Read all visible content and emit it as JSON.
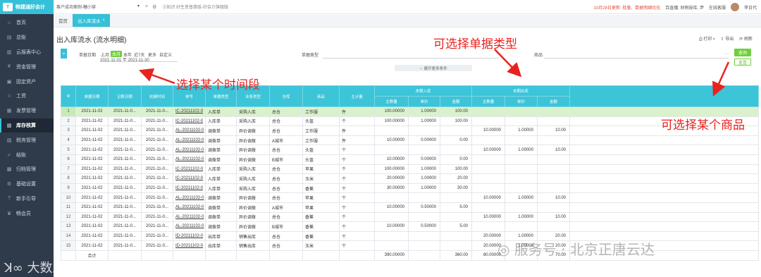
{
  "app": {
    "logo_text": "畅捷通好会计",
    "logo_mark": "T"
  },
  "sidebar": {
    "items": [
      {
        "label": "首页",
        "icon": "⌂"
      },
      {
        "label": "总账",
        "icon": "▤"
      },
      {
        "label": "云报表中心",
        "icon": "▥"
      },
      {
        "label": "资金管理",
        "icon": "¥"
      },
      {
        "label": "固定资产",
        "icon": "▣"
      },
      {
        "label": "工资",
        "icon": "☺"
      },
      {
        "label": "发票管理",
        "icon": "▦"
      },
      {
        "label": "库存核算",
        "icon": "▧"
      },
      {
        "label": "税务管理",
        "icon": "▨"
      },
      {
        "label": "结账",
        "icon": "✓"
      },
      {
        "label": "归档管理",
        "icon": "▩"
      },
      {
        "label": "基础设置",
        "icon": "⚙"
      },
      {
        "label": "新手引导",
        "icon": "?"
      },
      {
        "label": "畅会员",
        "icon": "♛"
      }
    ],
    "active_index": 7
  },
  "topbar": {
    "company": "客户成功案例-糖小穿",
    "company_caret": "▾",
    "add_icon": "+",
    "settings_icon": "⚙",
    "mid_text": "⑤知识 好生意普惠版-好会计旗舰版",
    "notice": "10月28日更新: 批量、数据明细优化",
    "live": "百直播: 财税秘库, 尹",
    "service": "在线客服",
    "user": "李日代"
  },
  "tabs": [
    {
      "label": "首页",
      "closable": false
    },
    {
      "label": "出入库流水",
      "closable": true
    }
  ],
  "page": {
    "title": "出入库流水 (流水明细)",
    "actions": {
      "print": "打印",
      "export": "导出",
      "refresh": "刷新"
    }
  },
  "filters": {
    "date_label": "单据日期",
    "date_chips": [
      "上月",
      "本月",
      "本年",
      "近7天",
      "更多",
      "自定义"
    ],
    "date_active_index": 1,
    "date_range": "2021-11-01 至 2021-11-30",
    "type_label": "单据类型",
    "product_label": "商品",
    "more_conditions": "展开更多条件",
    "search_btn": "查询",
    "reset_btn": "重置",
    "expand_icon": "»"
  },
  "annotations": {
    "doc_type": "可选择单据类型",
    "time_range": "选择某个时间段",
    "product": "可选择某个商品"
  },
  "table": {
    "group_headers": {
      "in": "本期入库",
      "out": "本期出库"
    },
    "headers": [
      "单据日期",
      "记账日期",
      "创建时间",
      "单号",
      "单据类型",
      "业务类型",
      "仓库",
      "商品",
      "主计量",
      "主数量",
      "单价",
      "金额",
      "主数量",
      "单价",
      "金额"
    ],
    "settings_icon": "⚙",
    "rows": [
      [
        "2021-11-02",
        "2021-11-0...",
        "2021-11-0...",
        "IC-20211102-0",
        "入库单",
        "采购入库",
        "总仓",
        "工作服",
        "件",
        "100.00000",
        "1.00000",
        "100.00",
        "",
        "",
        ""
      ],
      [
        "2021-11-02",
        "2021-11-0...",
        "2021-11-0...",
        "IC-20211102-0",
        "入库单",
        "采购入库",
        "总仓",
        "头盔",
        "个",
        "100.00000",
        "1.00000",
        "100.00",
        "",
        "",
        ""
      ],
      [
        "2021-11-02",
        "2021-11-0...",
        "2021-11-0...",
        "AL-20211102-0",
        "调拨单",
        "异价调拨",
        "总仓",
        "工作服",
        "件",
        "",
        "",
        "",
        "10.00000",
        "1.00000",
        "10.00"
      ],
      [
        "2021-11-02",
        "2021-11-0...",
        "2021-11-0...",
        "AL-20211102-0",
        "调拨单",
        "异价调拨",
        "A城市",
        "工作服",
        "件",
        "10.00000",
        "0.00000",
        "0.00",
        "",
        "",
        ""
      ],
      [
        "2021-11-02",
        "2021-11-0...",
        "2021-11-0...",
        "AL-20211102-0",
        "调拨单",
        "异价调拨",
        "总仓",
        "头盔",
        "个",
        "",
        "",
        "",
        "10.00000",
        "1.00000",
        "10.00"
      ],
      [
        "2021-11-02",
        "2021-11-0...",
        "2021-11-0...",
        "AL-20211102-0",
        "调拨单",
        "异价调拨",
        "B城市",
        "头盔",
        "个",
        "10.00000",
        "0.00000",
        "0.00",
        "",
        "",
        ""
      ],
      [
        "2021-11-02",
        "2021-11-0...",
        "2021-11-0...",
        "IC-20211102-0",
        "入库单",
        "采购入库",
        "总仓",
        "苹果",
        "个",
        "100.00000",
        "1.00000",
        "100.00",
        "",
        "",
        ""
      ],
      [
        "2021-11-02",
        "2021-11-0...",
        "2021-11-0...",
        "IC-20211102-0",
        "入库单",
        "采购入库",
        "总仓",
        "玉米",
        "个",
        "20.00000",
        "1.00000",
        "20.00",
        "",
        "",
        ""
      ],
      [
        "2021-11-02",
        "2021-11-0...",
        "2021-11-0...",
        "IC-20211102-0",
        "入库单",
        "采购入库",
        "总仓",
        "香蕉",
        "个",
        "30.00000",
        "1.00000",
        "30.00",
        "",
        "",
        ""
      ],
      [
        "2021-11-02",
        "2021-11-0...",
        "2021-11-0...",
        "AL-20211102-0",
        "调拨单",
        "异价调拨",
        "总仓",
        "苹果",
        "个",
        "",
        "",
        "",
        "10.00000",
        "1.00000",
        "10.00"
      ],
      [
        "2021-11-02",
        "2021-11-0...",
        "2021-11-0...",
        "AL-20211102-0",
        "调拨单",
        "异价调拨",
        "A城市",
        "苹果",
        "个",
        "10.00000",
        "0.50000",
        "5.00",
        "",
        "",
        ""
      ],
      [
        "2021-11-02",
        "2021-11-0...",
        "2021-11-0...",
        "AL-20211102-0",
        "调拨单",
        "异价调拨",
        "总仓",
        "香蕉",
        "个",
        "",
        "",
        "",
        "10.00000",
        "1.00000",
        "10.00"
      ],
      [
        "2021-11-02",
        "2021-11-0...",
        "2021-11-0...",
        "AL-20211102-0",
        "调拨单",
        "异价调拨",
        "B城市",
        "香蕉",
        "个",
        "10.00000",
        "0.50000",
        "5.00",
        "",
        "",
        ""
      ],
      [
        "2021-11-02",
        "2021-11-0...",
        "2021-11-0...",
        "ID-20211102-0",
        "出库单",
        "销售出库",
        "总仓",
        "香蕉",
        "个",
        "",
        "",
        "",
        "20.00000",
        "1.00000",
        "20.00"
      ],
      [
        "2021-11-02",
        "2021-11-0...",
        "2021-11-0...",
        "ID-20211102-0",
        "出库单",
        "销售出库",
        "总仓",
        "玉米",
        "个",
        "",
        "",
        "",
        "20.00000",
        "1.00000",
        "20.00"
      ]
    ],
    "total_label": "合计",
    "total": {
      "in_qty": "390.00000",
      "in_amt": "360.00",
      "out_qty": "80.00000",
      "out_amt": "70.00"
    }
  },
  "watermarks": {
    "service": "服务号 · 北京正唐云达",
    "bigdata": "大数跨境"
  },
  "colors": {
    "accent": "#34c0d8",
    "green": "#6fcf3c",
    "annotation": "#e8231f",
    "sidebar": "#2f3a4a"
  }
}
